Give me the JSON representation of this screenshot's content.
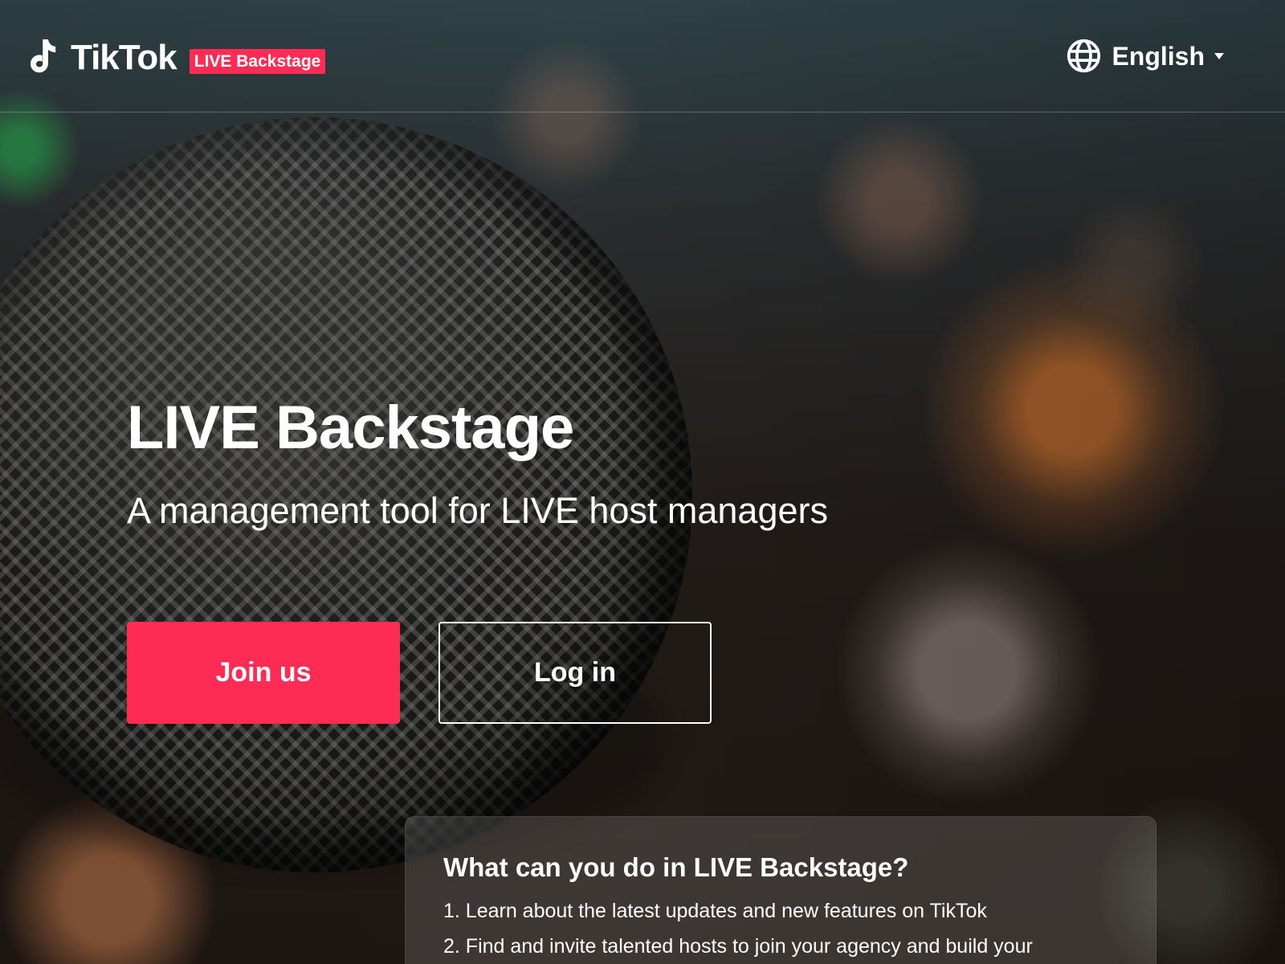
{
  "header": {
    "logo_text": "TikTok",
    "logo_badge": "LIVE Backstage",
    "language_label": "English",
    "icons": {
      "logo": "tiktok-note-icon",
      "language": "globe-icon",
      "dropdown": "caret-down-icon"
    }
  },
  "hero": {
    "title": "LIVE Backstage",
    "subtitle": "A management tool for LIVE host managers",
    "join_label": "Join us",
    "login_label": "Log in"
  },
  "info": {
    "title": "What can you do in LIVE Backstage?",
    "items": [
      "1. Learn about the latest updates and new features on TikTok",
      "2. Find and invite talented hosts to join your agency and build your"
    ]
  },
  "colors": {
    "accent": "#fe2c55",
    "text": "#ffffff"
  }
}
